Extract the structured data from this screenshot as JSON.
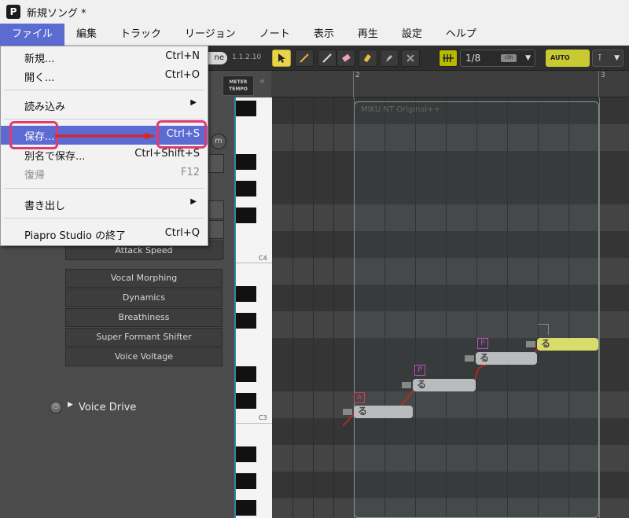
{
  "window": {
    "title": "新規ソング *",
    "app_icon": "P"
  },
  "menubar": {
    "items": [
      "ファイル",
      "編集",
      "トラック",
      "リージョン",
      "ノート",
      "表示",
      "再生",
      "設定",
      "ヘルプ"
    ]
  },
  "file_menu": {
    "items": [
      {
        "label": "新規...",
        "shortcut": "Ctrl+N"
      },
      {
        "label": "開く...",
        "shortcut": "Ctrl+O"
      },
      {
        "label": "読み込み",
        "submenu": true
      },
      {
        "label": "保存...",
        "shortcut": "Ctrl+S",
        "highlighted": true
      },
      {
        "label": "別名で保存...",
        "shortcut": "Ctrl+Shift+S"
      },
      {
        "label": "復帰",
        "shortcut": "F12",
        "disabled": true
      },
      {
        "label": "書き出し",
        "submenu": true
      },
      {
        "label": "Piapro Studio の終了",
        "shortcut": "Ctrl+Q"
      }
    ]
  },
  "toolbar": {
    "pill_text": "ne",
    "version": "1.1.2.10",
    "snap": "1/8",
    "snap_mini": "r3h",
    "auto_label": "AUTO",
    "auto_dd": "⊺"
  },
  "meter_tempo": {
    "line1": "METER",
    "line2": "TEMPO"
  },
  "left_panel": {
    "partial_param": "Attack Speed",
    "params": [
      "Vocal Morphing",
      "Dynamics",
      "Breathiness",
      "Super Formant Shifter",
      "Voice Voltage"
    ],
    "voice_drive": "Voice Drive"
  },
  "ruler": {
    "bar2": "2",
    "bar3": "3"
  },
  "piano": {
    "c4": "C4",
    "c3": "C3"
  },
  "region": {
    "name": "MIKU NT Original++"
  },
  "notes": [
    {
      "lyric": "る",
      "tag": "A"
    },
    {
      "lyric": "る",
      "tag": "P"
    },
    {
      "lyric": "る",
      "tag": "P"
    },
    {
      "lyric": "る"
    }
  ],
  "colors": {
    "menu_highlight": "#5b6bd1",
    "callout": "#e23a70",
    "pitch_line": "#d42020",
    "selected_note": "#d8dc6a"
  }
}
